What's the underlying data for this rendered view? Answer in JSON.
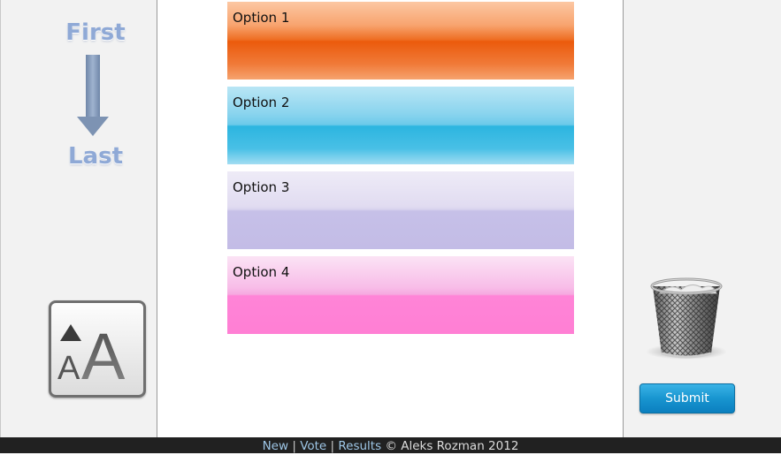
{
  "order_hint": {
    "first_label": "First",
    "last_label": "Last"
  },
  "options": [
    {
      "label": "Option 1",
      "color": "#eb5a0c"
    },
    {
      "label": "Option 2",
      "color": "#2cb5e0"
    },
    {
      "label": "Option 3",
      "color": "#c6c0e8"
    },
    {
      "label": "Option 4",
      "color": "#ff84d7"
    }
  ],
  "actions": {
    "submit_label": "Submit"
  },
  "footer": {
    "links": [
      "New",
      "Vote",
      "Results"
    ],
    "separator": "|",
    "copyright": "© Aleks Rozman 2012"
  }
}
